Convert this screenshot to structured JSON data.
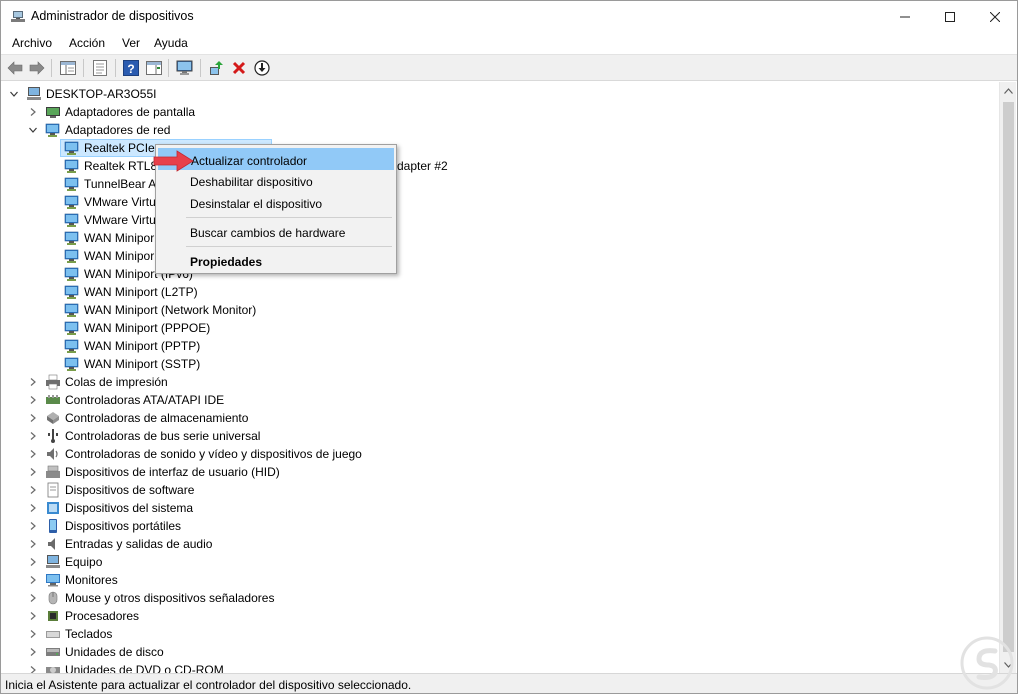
{
  "window": {
    "title": "Administrador de dispositivos"
  },
  "menu": [
    "Archivo",
    "Acción",
    "Ver",
    "Ayuda"
  ],
  "tree": {
    "root": "DESKTOP-AR3O55I",
    "network_children": [
      "Realtek PCIe",
      "Realtek RTL81",
      "TunnelBear A",
      "VMware Virtu",
      "VMware Virtu",
      "WAN Minipor",
      "WAN Minipor",
      "WAN Miniport (IPv6)",
      "WAN Miniport (L2TP)",
      "WAN Miniport (Network Monitor)",
      "WAN Miniport (PPPOE)",
      "WAN Miniport (PPTP)",
      "WAN Miniport (SSTP)"
    ],
    "partial_behind_menu": "dapter #2",
    "categories_top": [
      "Adaptadores de pantalla",
      "Adaptadores de red"
    ],
    "categories_bottom": [
      "Colas de impresión",
      "Controladoras ATA/ATAPI IDE",
      "Controladoras de almacenamiento",
      "Controladoras de bus serie universal",
      "Controladoras de sonido y vídeo y dispositivos de juego",
      "Dispositivos de interfaz de usuario (HID)",
      "Dispositivos de software",
      "Dispositivos del sistema",
      "Dispositivos portátiles",
      "Entradas y salidas de audio",
      "Equipo",
      "Monitores",
      "Mouse y otros dispositivos señaladores",
      "Procesadores",
      "Teclados",
      "Unidades de disco",
      "Unidades de DVD o CD-ROM"
    ]
  },
  "context_menu": {
    "update_driver": "Actualizar controlador",
    "disable_device": "Deshabilitar dispositivo",
    "uninstall_device": "Desinstalar el dispositivo",
    "scan_hardware": "Buscar cambios de hardware",
    "properties": "Propiedades"
  },
  "status": {
    "text": "Inicia el Asistente para actualizar el controlador del dispositivo seleccionado."
  },
  "colors": {
    "highlight": "#91c9f7",
    "selection": "#cce8ff",
    "arrow": "#e8404a",
    "uninstall_x": "#d41a1a"
  }
}
